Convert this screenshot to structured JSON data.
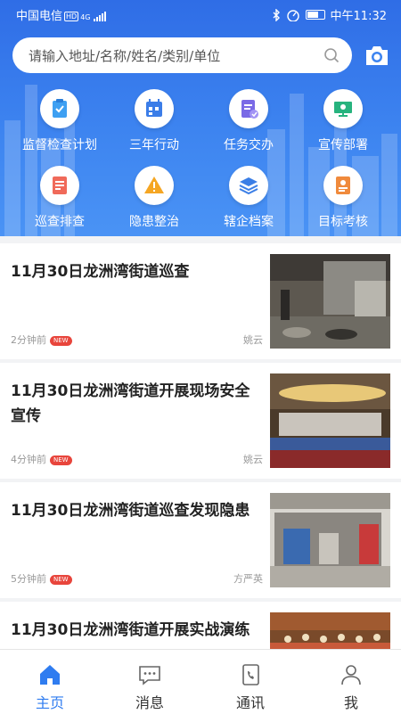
{
  "status_bar": {
    "carrier": "中国电信",
    "network_badge": "HD",
    "network_type": "4G",
    "time": "中午11:32"
  },
  "search": {
    "placeholder": "请输入地址/名称/姓名/类别/单位"
  },
  "icons": {
    "camera": "camera-icon",
    "search": "search-icon"
  },
  "functions": [
    {
      "label": "监督检查计划",
      "icon": "checklist-clipboard-icon"
    },
    {
      "label": "三年行动",
      "icon": "calendar-icon"
    },
    {
      "label": "任务交办",
      "icon": "task-document-icon"
    },
    {
      "label": "宣传部署",
      "icon": "presentation-board-icon"
    },
    {
      "label": "巡查排查",
      "icon": "inspection-form-icon"
    },
    {
      "label": "隐患整治",
      "icon": "warning-triangle-icon"
    },
    {
      "label": "辖企档案",
      "icon": "layers-stack-icon"
    },
    {
      "label": "目标考核",
      "icon": "assessment-document-icon"
    }
  ],
  "news": [
    {
      "title": "11月30日龙洲湾街道巡查",
      "time": "2分钟前",
      "badge": "NEW",
      "author": "姚云",
      "image": "kitchen-inspection-photo"
    },
    {
      "title": "11月30日龙洲湾街道开展现场安全宣传",
      "time": "4分钟前",
      "badge": "NEW",
      "author": "姚云",
      "image": "meeting-hall-photo"
    },
    {
      "title": "11月30日龙洲湾街道巡查发现隐患",
      "time": "5分钟前",
      "badge": "NEW",
      "author": "方严英",
      "image": "storefront-photo"
    },
    {
      "title": "11月30日龙洲湾街道开展实战演练",
      "time": "",
      "badge": "",
      "author": "",
      "image": "outdoor-drill-photo"
    }
  ],
  "tabs": [
    {
      "label": "主页",
      "icon": "home-icon",
      "active": true
    },
    {
      "label": "消息",
      "icon": "message-icon",
      "active": false
    },
    {
      "label": "通讯",
      "icon": "phone-book-icon",
      "active": false
    },
    {
      "label": "我",
      "icon": "user-icon",
      "active": false
    }
  ],
  "colors": {
    "primary": "#2f7cf0",
    "header": "#3d84f0",
    "badge": "#e8453c"
  }
}
